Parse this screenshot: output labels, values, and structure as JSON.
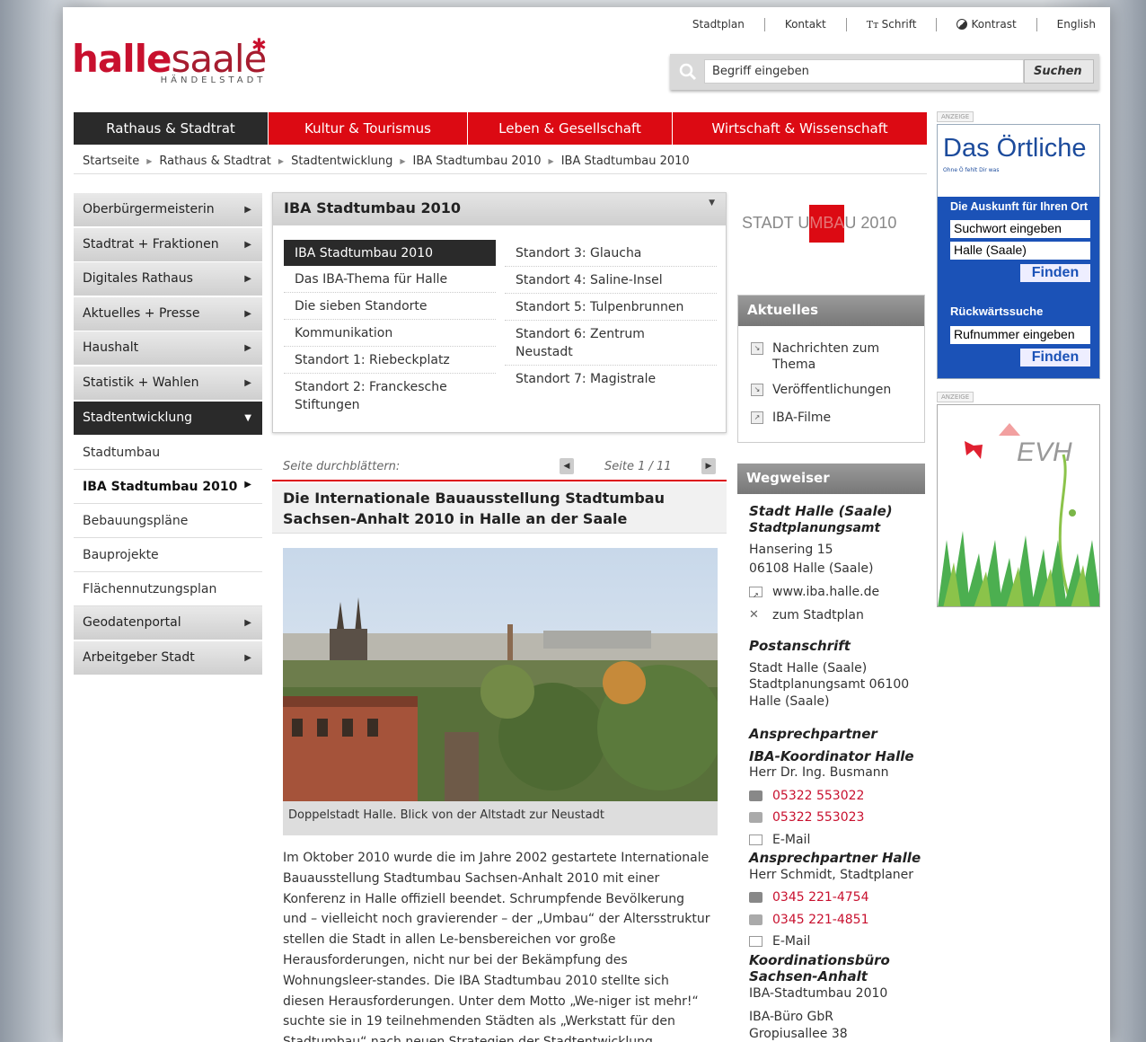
{
  "toplinks": [
    "Stadtplan",
    "Kontakt",
    "Schrift",
    "Kontrast",
    "English"
  ],
  "logo": {
    "part1": "halle",
    "part2": "saale",
    "sub": "HÄNDELSTADT"
  },
  "search": {
    "placeholder": "Begriff eingeben",
    "button": "Suchen"
  },
  "nav": [
    "Rathaus & Stadtrat",
    "Kultur & Tourismus",
    "Leben & Gesellschaft",
    "Wirtschaft & Wissenschaft"
  ],
  "breadcrumb": [
    "Startseite",
    "Rathaus & Stadtrat",
    "Stadtentwicklung",
    "IBA Stadtumbau 2010",
    "IBA Stadtumbau 2010"
  ],
  "leftmenu": {
    "items": [
      "Oberbürgermeisterin",
      "Stadtrat + Fraktionen",
      "Digitales Rathaus",
      "Aktuelles + Presse",
      "Haushalt",
      "Statistik + Wahlen",
      "Stadtentwicklung"
    ],
    "sub": [
      "Stadtumbau",
      "IBA Stadtumbau 2010",
      "Bebauungspläne",
      "Bauprojekte",
      "Flächennutzungsplan"
    ],
    "after": [
      "Geodatenportal",
      "Arbeitgeber Stadt"
    ]
  },
  "centerbox": {
    "title": "IBA Stadtumbau 2010",
    "col1": [
      "IBA Stadtumbau 2010",
      "Das IBA-Thema für Halle",
      "Die sieben Standorte",
      "Kommunikation",
      "Standort 1: Riebeckplatz",
      "Standort 2: Franckesche Stiftungen"
    ],
    "col2": [
      "Standort 3: Glaucha",
      "Standort 4: Saline-Insel",
      "Standort 5: Tulpenbrunnen",
      "Standort 6: Zentrum Neustadt",
      "Standort 7: Magistrale"
    ]
  },
  "pager": {
    "label": "Seite durchblättern:",
    "page": "Seite 1 / 11"
  },
  "article": {
    "title": "Die Internationale Bauausstellung Stadtumbau Sachsen-Anhalt 2010 in Halle an der Saale",
    "caption": "Doppelstadt Halle. Blick von der Altstadt zur Neustadt",
    "lines": [
      "Im Oktober 2010 wurde die im Jahre 2002 gestartete Internationale",
      "Bauausstellung Stadtumbau Sachsen-Anhalt 2010 mit einer",
      "Konferenz in Halle offiziell beendet. Schrumpfende Bevölkerung",
      "und – vielleicht noch gravierender – der „Umbau“ der Altersstruktur",
      "stellen die Stadt in allen Le-bensbereichen vor große",
      "Herausforderungen, nicht nur bei der Bekämpfung des",
      "Wohnungsleer-standes. Die IBA Stadtumbau 2010 stellte sich",
      "diesen Herausforderungen. Unter dem Motto „We-niger ist mehr!“",
      "suchte sie in 19 teilnehmenden Städten als „Werkstatt für den",
      "Stadtumbau“ nach neuen Strategien der Stadtentwicklung"
    ]
  },
  "stadtumbau_logo": {
    "a": "STADT U",
    "b": "MBA",
    "c": "U 2010"
  },
  "aktuelles": {
    "title": "Aktuelles",
    "links": [
      "Nachrichten zum Thema",
      "Veröffentlichungen",
      "IBA-Filme"
    ]
  },
  "wegweiser": {
    "title": "Wegweiser",
    "org1": "Stadt Halle (Saale)",
    "org2": "Stadtplanungsamt",
    "addr1": "Hansering 15",
    "addr2": "06108 Halle (Saale)",
    "web": "www.iba.halle.de",
    "map": "zum Stadtplan",
    "post_h": "Postanschrift",
    "post1": "Stadt Halle (Saale)",
    "post2": "Stadtplanungsamt 06100",
    "post3": "Halle (Saale)",
    "ap_h": "Ansprechpartner",
    "k1_h": "IBA-Koordinator Halle",
    "k1_name": "Herr Dr. Ing. Busmann",
    "k1_tel": "05322 553022",
    "k1_fax": "05322 553023",
    "email": "E-Mail",
    "k2_h": "Ansprechpartner Halle",
    "k2_name": "Herr Schmidt, Stadtplaner",
    "k2_tel": "0345 221-4754",
    "k2_fax": "0345 221-4851",
    "k3_h1": "Koordinationsbüro",
    "k3_h2": "Sachsen-Anhalt",
    "k3_l1": "IBA-Stadtumbau 2010",
    "k3_l2": "IBA-Büro GbR",
    "k3_l3": "Gropiusallee 38"
  },
  "ads": {
    "label": "ANZEIGE",
    "oertliche": {
      "title": "Das Örtliche",
      "tag": "Ohne Ö fehlt Dir was",
      "h1": "Die Auskunft für Ihren Ort",
      "in1": "Suchwort eingeben",
      "in2": "Halle (Saale)",
      "btn": "Finden",
      "h2": "Rückwärtssuche",
      "in3": "Rufnummer eingeben"
    },
    "evh": "EVH"
  },
  "colors": {
    "red": "#dc0a13",
    "dark": "#2a2a2a",
    "blue": "#1b52b7"
  }
}
